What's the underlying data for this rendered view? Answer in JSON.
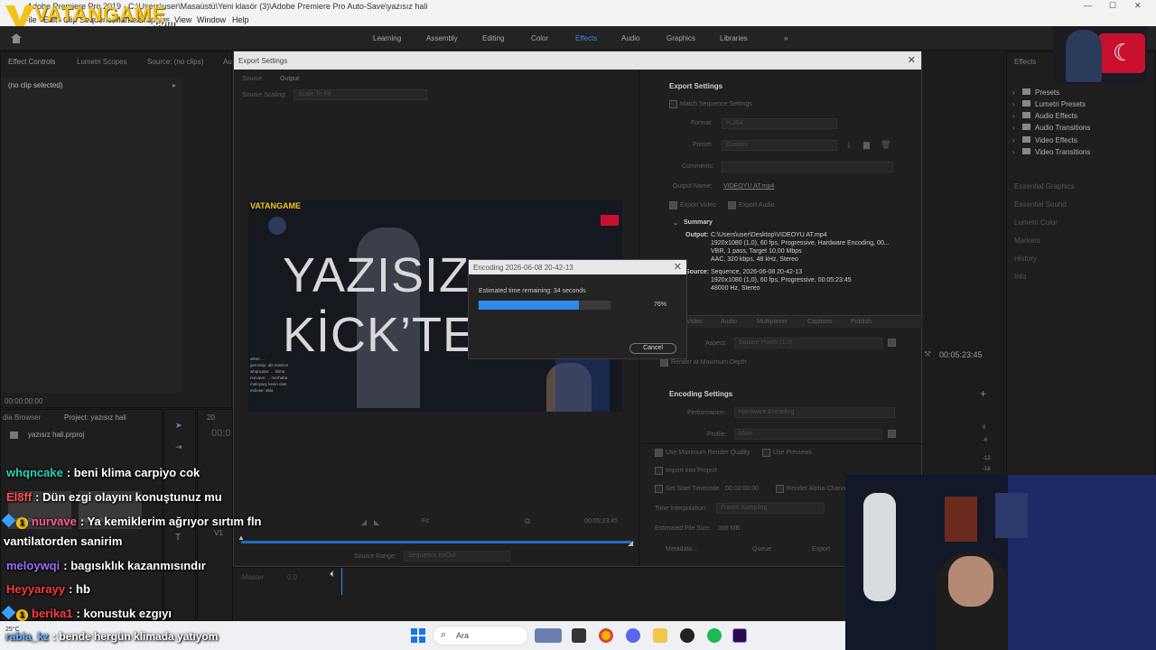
{
  "window": {
    "title": "Adobe Premiere Pro 2019 - C:\\Users\\user\\Masaüstü\\Yeni klasör (3)\\Adobe Premiere Pro Auto-Save\\yazısız hali",
    "menu": [
      "File",
      "Edit",
      "Clip",
      "Sequence",
      "Markers",
      "Graphics",
      "View",
      "Window",
      "Help"
    ]
  },
  "watermark": {
    "brand": "VATANGAME",
    "suffix": ".com"
  },
  "workspaces": {
    "items": [
      "Learning",
      "Assembly",
      "Editing",
      "Color",
      "Effects",
      "Audio",
      "Graphics",
      "Libraries"
    ],
    "active": "Effects",
    "overflow": "»"
  },
  "left_panel": {
    "tabs": [
      "Effect Controls",
      "Lumetri Scopes",
      "Source: (no clips)",
      "Au"
    ],
    "no_clip": "(no clip selected)",
    "timecode": "00:00:00:00"
  },
  "project_panel": {
    "tabs": [
      "dia Browser",
      "Project: yazısız hali"
    ],
    "file": "yazısız hali.prproj",
    "thumb_date1": "2026-06-08 ...",
    "thumb_time1": "3:28:19",
    "thumb_date2": "2026-06-08 ...",
    "thumb_time2": "5:23:45"
  },
  "timeline": {
    "seq_tab": "20",
    "timecode": "00:0",
    "track_label": "Master",
    "track_val": "0.0",
    "v1": "V1",
    "a1": "A1"
  },
  "export_dialog": {
    "title": "Export Settings",
    "close": "✕",
    "tabs": [
      "Source",
      "Output"
    ],
    "source_scaling_label": "Source Scaling:",
    "source_scaling_value": "Scale To Fit",
    "timecode_end": "00:05:23:45",
    "fit_label": "Fit",
    "source_range_label": "Source Range:",
    "source_range_value": "Sequence In/Out",
    "settings_header": "Export Settings",
    "match_sequence": "Match Sequence Settings",
    "format_label": "Format:",
    "format_value": "H.264",
    "preset_label": "Preset:",
    "preset_value": "Custom",
    "comments_label": "Comments:",
    "output_name_label": "Output Name:",
    "output_name_value": "VIDEOYU AT.mp4",
    "export_video": "Export Video",
    "export_audio": "Export Audio",
    "summary_header": "Summary",
    "summary_output_label": "Output:",
    "summary_output": [
      "C:\\Users\\user\\Desktop\\VIDEOYU AT.mp4",
      "1920x1080 (1,0), 60 fps, Progressive, Hardware Encoding, 00...",
      "VBR, 1 pass, Target 10,00 Mbps",
      "AAC, 320 kbps, 48 kHz, Stereo"
    ],
    "summary_source_label": "Source:",
    "summary_source": [
      "Sequence, 2026-06-08 20-42-13",
      "1920x1080 (1,0), 60 fps, Progressive, 00:05:23:45",
      "48000 Hz, Stereo"
    ],
    "output_tabs": [
      "Video",
      "Audio",
      "Multiplexer",
      "Captions",
      "Publish"
    ],
    "aspect_label": "Aspect:",
    "aspect_value": "Square Pixels (1.0)",
    "render_max_depth": "Render at Maximum Depth",
    "encoding_header": "Encoding Settings",
    "performance_label": "Performance:",
    "performance_value": "Hardware Encoding",
    "profile_label": "Profile:",
    "profile_value": "Main",
    "use_max_quality": "Use Maximum Render Quality",
    "use_previews": "Use Previews",
    "import_project": "Import into Project",
    "set_start_tc": "Set Start Timecode",
    "start_tc_value": "00:00:00:00",
    "render_alpha": "Render Alpha Channel Only",
    "time_interp_label": "Time Interpolation:",
    "time_interp_value": "Frame Sampling",
    "file_size_label": "Estimated File Size:",
    "file_size_value": "398 MB",
    "btn_metadata": "Metadata...",
    "btn_queue": "Queue",
    "btn_export": "Export"
  },
  "preview": {
    "logo": "VATANGAME",
    "line1": "YAZISIZ",
    "line2": "KİCK’TE",
    "chat_lines": [
      "alinin: ...",
      "gemzalp: abi nasılsın",
      "whqncake: ... klima",
      "nurvave: ... merhaba",
      "meloywq: kesin olan",
      "esbuke: abla"
    ]
  },
  "encoding_dialog": {
    "title": "Encoding 2026-06-08 20-42-13",
    "close": "✕",
    "eta": "Estimated time remaining: 34 seconds",
    "percent_text": "76%",
    "progress": 0.76,
    "cancel": "Cancel"
  },
  "right_panel": {
    "title": "Effects",
    "tree": [
      "Presets",
      "Lumetri Presets",
      "Audio Effects",
      "Audio Transitions",
      "Video Effects",
      "Video Transitions"
    ],
    "sections": [
      "Essential Graphics",
      "Essential Sound",
      "Lumetri Color",
      "Markers",
      "History",
      "Info"
    ],
    "program_tc": "00:05:23:45",
    "meter_ticks": [
      "0",
      "-6",
      "-12",
      "-18"
    ]
  },
  "chat": [
    {
      "name": "whqncake",
      "color": "#25d3b5",
      "text": ": beni klima carpiyo cok"
    },
    {
      "name": "El8ff",
      "color": "#ff4f4f",
      "text": ": Dün ezgi olayını konuştunuz mu"
    },
    {
      "name": "nurvave",
      "color": "#ff5c9a",
      "text": ": Ya kemiklerim ağrıyor sırtım fln",
      "badge": "1"
    },
    {
      "name": "",
      "color": "#ffffff",
      "text": "vantilatorden sanirim"
    },
    {
      "name": "meloywqi",
      "color": "#9b6bff",
      "text": ": bagısıklık kazanmısındır"
    },
    {
      "name": "Heyyarayy",
      "color": "#ff3b3b",
      "text": ": hb"
    },
    {
      "name": "berika1",
      "color": "#ff3b3b",
      "text": ": konustuk ezgıyı",
      "badge": "1"
    },
    {
      "name": "rabia_kz",
      "color": "#6fb2ff",
      "text": ": bende hergün klimada yatıyom"
    }
  ],
  "taskbar": {
    "weather": "25°C",
    "search_label": "Ara"
  },
  "colors": {
    "accent": "#2d8ceb",
    "progress": "#2d8ceb",
    "panel_bg": "#1e1e1e"
  }
}
